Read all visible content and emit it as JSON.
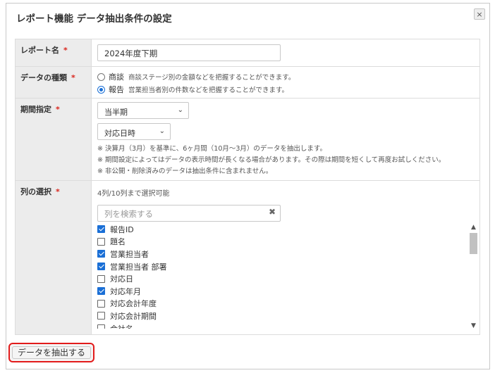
{
  "dialog": {
    "title": "レポート機能 データ抽出条件の設定",
    "close_icon": "×"
  },
  "form": {
    "report_name": {
      "label": "レポート名",
      "required": "*",
      "value": "2024年度下期"
    },
    "data_type": {
      "label": "データの種類",
      "required": "*",
      "options": [
        {
          "label": "商談",
          "desc": "商談ステージ別の金額などを把握することができます。",
          "selected": false
        },
        {
          "label": "報告",
          "desc": "営業担当者別の件数などを把握することができます。",
          "selected": true
        }
      ]
    },
    "period": {
      "label": "期間指定",
      "required": "*",
      "select1": "当半期",
      "select2": "対応日時",
      "notes": [
        "※ 決算月（3月）を基準に、6ヶ月間（10月～3月）のデータを抽出します。",
        "※ 期間設定によってはデータの表示時間が長くなる場合があります。その際は期間を短くして再度お試しください。",
        "※ 非公開・削除済みのデータは抽出条件に含まれません。"
      ]
    },
    "columns": {
      "label": "列の選択",
      "required": "*",
      "count_text": "4列/10列まで選択可能",
      "search_placeholder": "列を検索する",
      "clear_icon": "✖",
      "items": [
        {
          "label": "報告ID",
          "checked": true
        },
        {
          "label": "題名",
          "checked": false
        },
        {
          "label": "営業担当者",
          "checked": true
        },
        {
          "label": "営業担当者 部署",
          "checked": true
        },
        {
          "label": "対応日",
          "checked": false
        },
        {
          "label": "対応年月",
          "checked": true
        },
        {
          "label": "対応会計年度",
          "checked": false
        },
        {
          "label": "対応会計期間",
          "checked": false
        },
        {
          "label": "会社名",
          "checked": false
        }
      ],
      "scroll_up": "▲",
      "scroll_down": "▼"
    }
  },
  "submit_label": "データを抽出する",
  "colors": {
    "accent": "#1a6fd6",
    "required": "#d9251c",
    "highlight": "#e21b1b"
  }
}
